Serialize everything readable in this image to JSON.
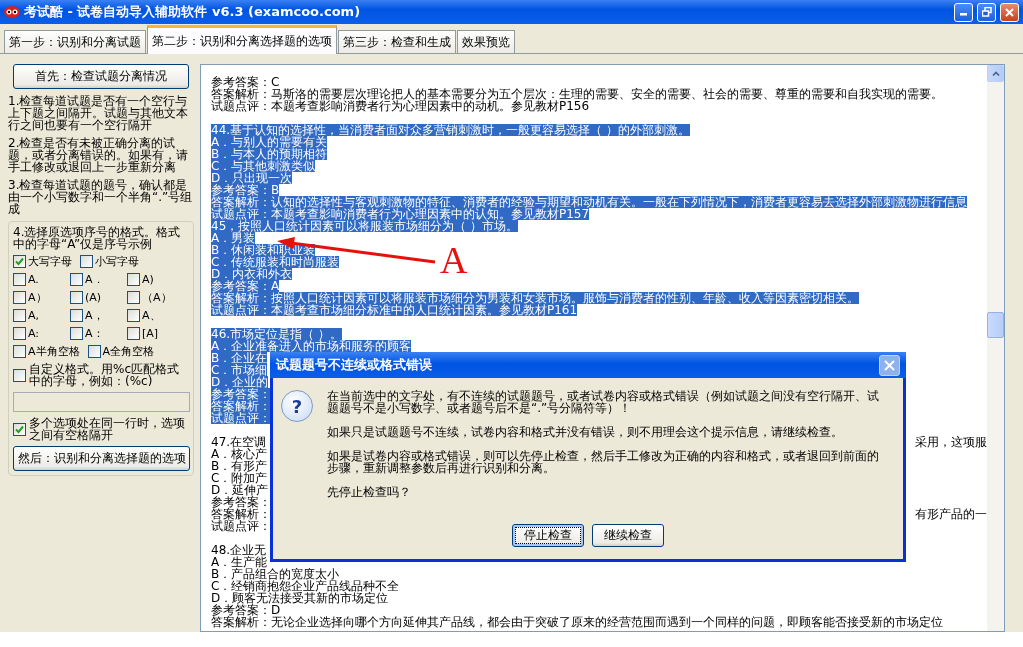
{
  "window": {
    "title": "考试酷 - 试卷自动导入辅助软件 v6.3 (examcoo.com)"
  },
  "tabs": [
    {
      "label": "第一步：识别和分离试题",
      "selected": false
    },
    {
      "label": "第二步：识别和分离选择题的选项",
      "selected": true
    },
    {
      "label": "第三步：检查和生成",
      "selected": false
    },
    {
      "label": "效果预览",
      "selected": false
    }
  ],
  "left_panel": {
    "check_button": "首先：检查试题分离情况",
    "instructions": [
      "1.检查每道试题是否有一个空行与上下题之间隔开。试题与其他文本行之间也要有一个空行隔开",
      "2.检查是否有未被正确分离的试题，或者分离错误的。如果有，请手工修改或退回上一步重新分离",
      "3.检查每道试题的题号，确认都是由一个小写数字和一个半角“.”号组成"
    ],
    "format_group": {
      "heading": "4.选择原选项序号的格式。格式中的字母“A”仅是序号示例",
      "case_options": [
        {
          "label": "大写字母",
          "checked": true
        },
        {
          "label": "小写字母",
          "checked": false
        }
      ],
      "format_options": [
        {
          "label": "A.",
          "checked": false
        },
        {
          "label": "A．",
          "checked": false
        },
        {
          "label": "A)",
          "checked": false
        },
        {
          "label": "A）",
          "checked": false
        },
        {
          "label": "(A)",
          "checked": false
        },
        {
          "label": "（A）",
          "checked": false
        },
        {
          "label": "A,",
          "checked": false
        },
        {
          "label": "A，",
          "checked": false
        },
        {
          "label": "A、",
          "checked": false
        },
        {
          "label": "A:",
          "checked": false
        },
        {
          "label": "A：",
          "checked": false
        },
        {
          "label": "[A]",
          "checked": false
        }
      ],
      "space_options": [
        {
          "label": "A半角空格",
          "checked": false
        },
        {
          "label": "A全角空格",
          "checked": false
        }
      ],
      "custom": {
        "label": "自定义格式。用%c匹配格式中的字母，例如：(%c)",
        "checked": false
      },
      "multi_option": {
        "label": "多个选项处在同一行时，选项之间有空格隔开",
        "checked": true
      },
      "action_button": "然后：识别和分离选择题的选项"
    }
  },
  "text_blocks": [
    {
      "lines": [
        {
          "text": "参考答案：C",
          "selected": false
        },
        {
          "text": "答案解析：马斯洛的需要层次理论把人的基本需要分为五个层次：生理的需要、安全的需要、社会的需要、尊重的需要和自我实现的需要。",
          "selected": false
        },
        {
          "text": "试题点评：本题考查影响消费者行为心理因素中的动机。参见教材P156",
          "selected": false
        }
      ]
    },
    {
      "lines": [
        {
          "text": "44.基于认知的选择性，当消费者面对众多营销刺激时，一般更容易选择（    ）的外部刺激。",
          "selected": true
        },
        {
          "text": "A．与别人的需要有关",
          "selected": true
        },
        {
          "text": "B．与本人的预期相符",
          "selected": true
        },
        {
          "text": "C．与其他刺激类似",
          "selected": true
        },
        {
          "text": "D．只出现一次",
          "selected": true
        },
        {
          "text": "参考答案：B",
          "selected": true
        },
        {
          "text": "答案解析：认知的选择性与客观刺激物的特征、消费者的经验与期望和动机有关。一般在下列情况下，消费者更容易去选择外部刺激物进行信息",
          "selected": true
        },
        {
          "text": "试题点评：本题考查影响消费者行为心理因素中的认知。参见教材P157",
          "selected": true
        },
        {
          "text": "45，按照人口统计因素可以将服装市场细分为（    ）市场。",
          "selected": true
        },
        {
          "text": "A．男装",
          "selected": true
        },
        {
          "text": "B．休闲装和职业装",
          "selected": true
        },
        {
          "text": "C．传统服装和时尚服装",
          "selected": true
        },
        {
          "text": "D．内衣和外衣",
          "selected": true
        },
        {
          "text": "参考答案：A",
          "selected": true
        },
        {
          "text": "答案解析：按照人口统计因素可以将服装市场细分为男装和女装市场。服饰与消费者的性别、年龄、收入等因素密切相关。",
          "selected": true
        },
        {
          "text": "试题点评：本题考查市场细分标准中的人口统计因素。参见教材P161",
          "selected": true
        }
      ]
    },
    {
      "lines": [
        {
          "text": "46.市场定位是指（    ）。",
          "selected": true
        },
        {
          "text": "A．企业准备进入的市场和服务的顾客",
          "selected": true
        },
        {
          "text": "B．企业在",
          "selected": true
        },
        {
          "text": "C．市场细",
          "selected": true
        },
        {
          "text": "D．企业的",
          "selected": true
        },
        {
          "text": "参考答案：",
          "selected": true
        },
        {
          "text": "答案解析：",
          "selected": true
        },
        {
          "text": "试题点评：",
          "selected": true
        }
      ]
    },
    {
      "lines": [
        {
          "text": "47.在空调",
          "selected": false,
          "tail": "采用，这项服"
        },
        {
          "text": "A．核心产",
          "selected": false
        },
        {
          "text": "B．有形产",
          "selected": false
        },
        {
          "text": "C．附加产",
          "selected": false
        },
        {
          "text": "D．延伸产",
          "selected": false
        },
        {
          "text": "参考答案：",
          "selected": false
        },
        {
          "text": "答案解析：",
          "selected": false,
          "tail": "有形产品的一"
        },
        {
          "text": "试题点评：",
          "selected": false
        }
      ]
    },
    {
      "lines": [
        {
          "text": "48.企业无",
          "selected": false
        },
        {
          "text": "A．生产能",
          "selected": false
        },
        {
          "text": "B．产品组合的宽度太小",
          "selected": false
        },
        {
          "text": "C．经销商抱怨企业产品线品种不全",
          "selected": false
        },
        {
          "text": "D．顾客无法接受其新的市场定位",
          "selected": false
        },
        {
          "text": "参考答案：D",
          "selected": false
        },
        {
          "text": "答案解析：无论企业选择向哪个方向延伸其产品线，都会由于突破了原来的经营范围而遇到一个同样的问题，即顾客能否接受新的市场定位",
          "selected": false
        }
      ]
    }
  ],
  "annotation": {
    "label": "A"
  },
  "dialog": {
    "title": "试题题号不连续或格式错误",
    "icon": "?",
    "paragraphs": [
      "在当前选中的文字处，有不连续的试题题号，或者试卷内容或格式错误（例如试题之间没有空行隔开、试题题号不是小写数字、或者题号后不是“.”号分隔符等）！",
      "如果只是试题题号不连续，试卷内容和格式并没有错误，则不用理会这个提示信息，请继续检查。",
      "如果是试卷内容或格式错误，则可以先停止检查，然后手工修改为正确的内容和格式，或者退回到前面的步骤，重新调整参数后再进行识别和分离。",
      "先停止检查吗？"
    ],
    "buttons": [
      {
        "label": "停止检查",
        "focused": true
      },
      {
        "label": "继续检查",
        "focused": false
      }
    ]
  }
}
